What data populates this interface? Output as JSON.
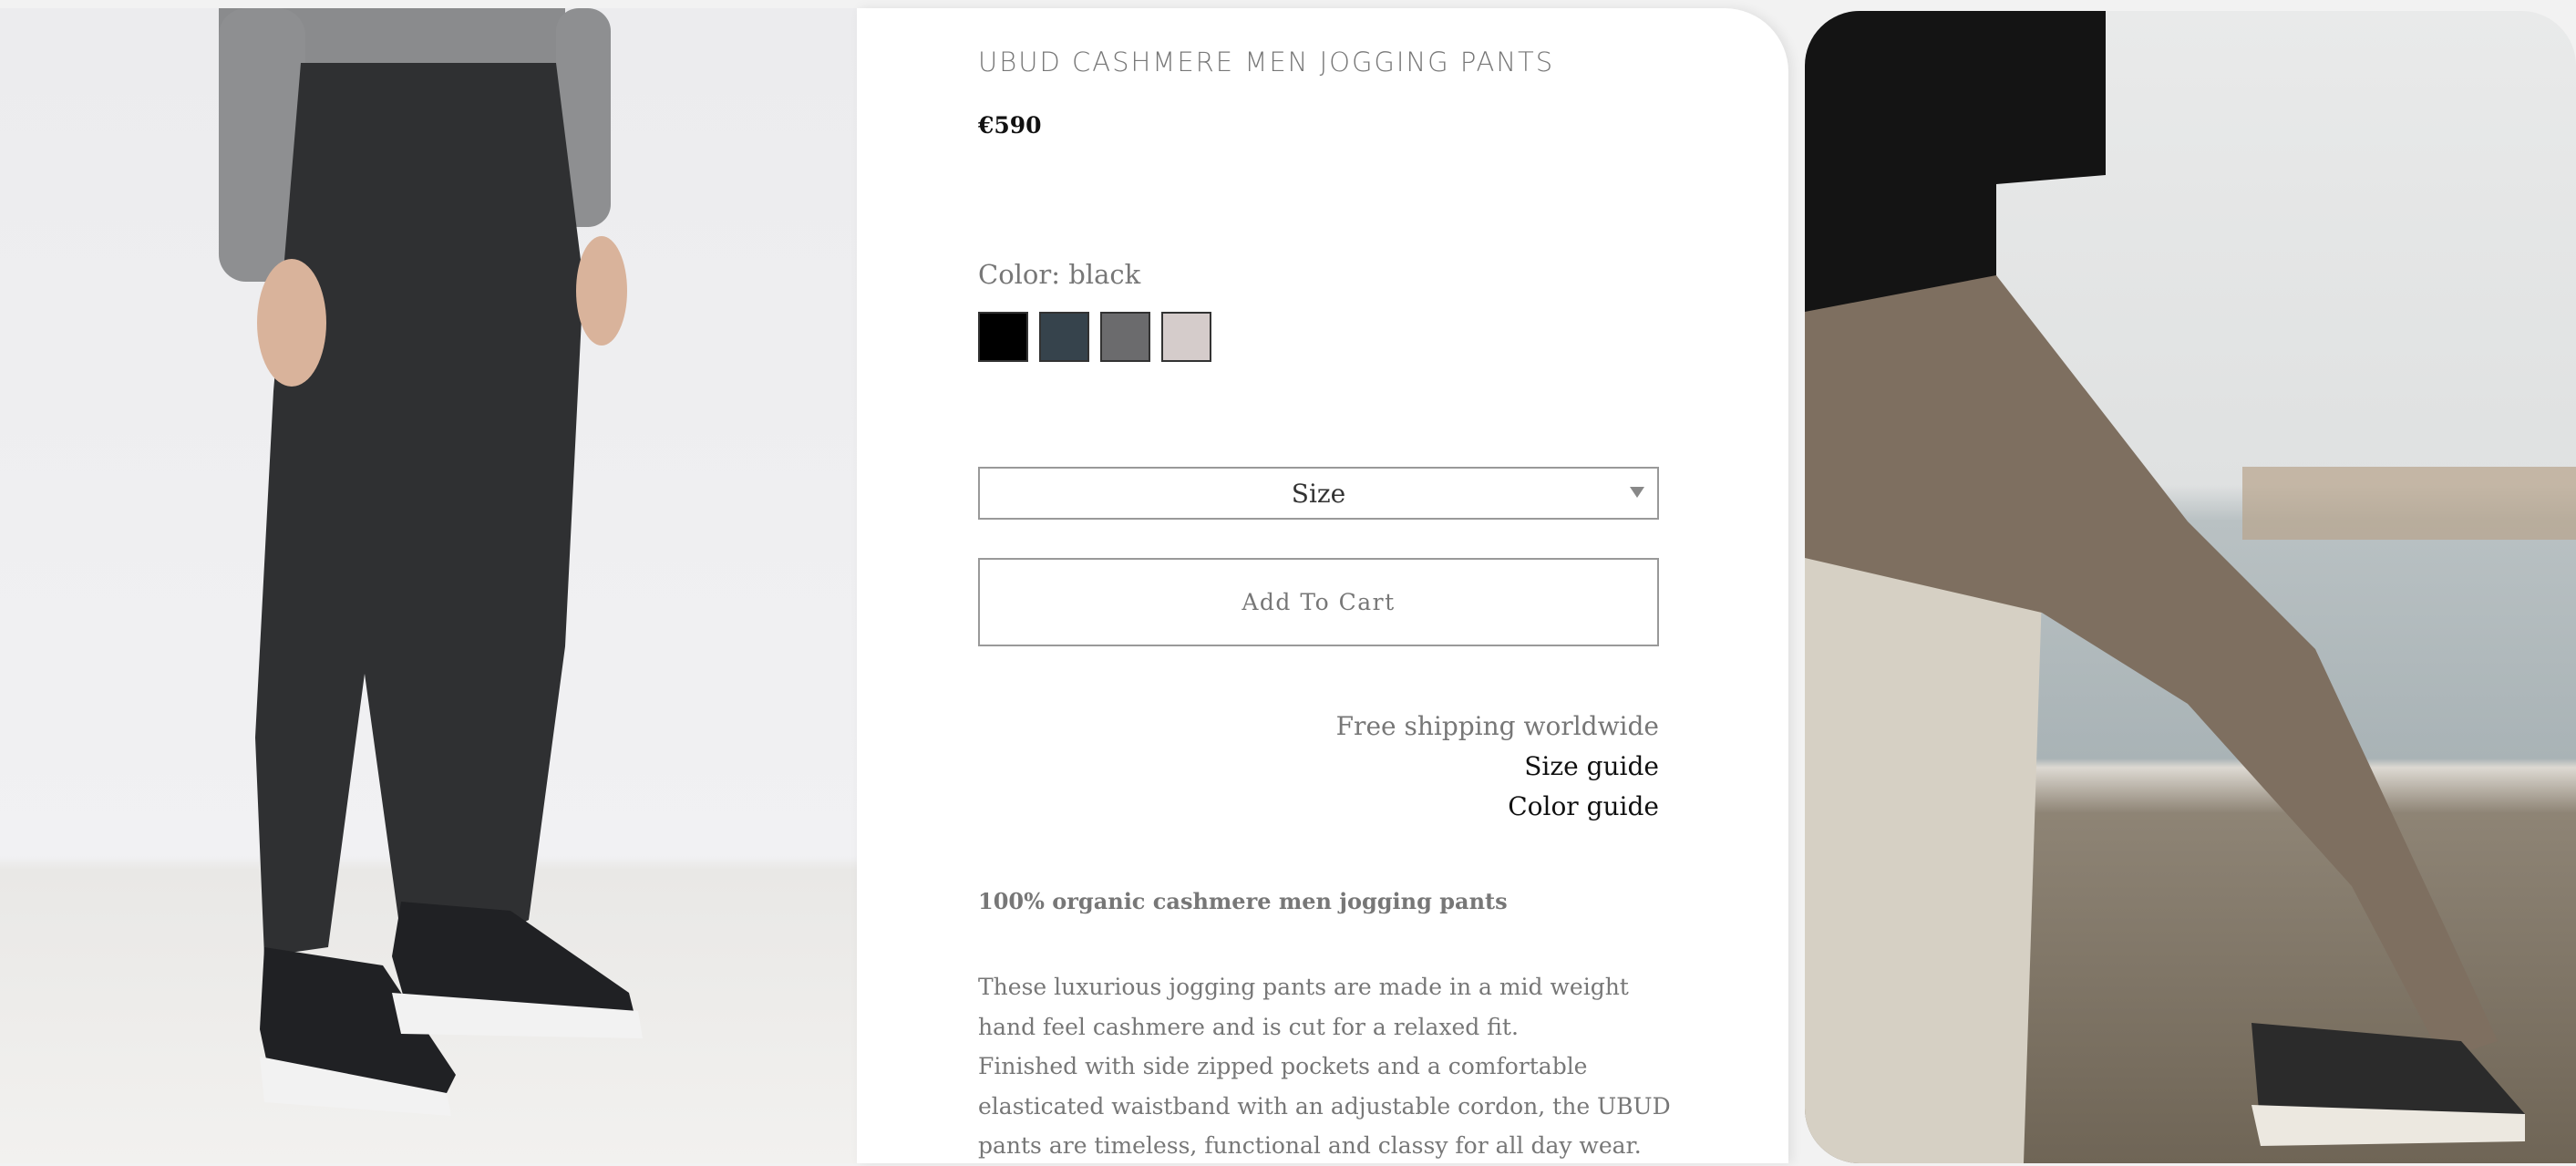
{
  "product": {
    "title": "UBUD CASHMERE MEN JOGGING PANTS",
    "price": "€590",
    "color_label": "Color: black",
    "swatches": [
      {
        "name": "black",
        "color": "#000000"
      },
      {
        "name": "navy",
        "color": "#36434c"
      },
      {
        "name": "grey",
        "color": "#6b6b6d"
      },
      {
        "name": "light-pink",
        "color": "#d5cccb"
      }
    ],
    "size_select": "Size",
    "add_to_cart": "Add To Cart",
    "shipping": "Free shipping worldwide",
    "size_guide": "Size guide",
    "color_guide": "Color guide",
    "description_heading": "100% organic cashmere men jogging pants",
    "description_lines": [
      "These luxurious jogging pants are made in a mid weight",
      "hand feel cashmere and is cut for a relaxed fit.",
      "Finished with side zipped pockets and a comfortable",
      "elasticated waistband with an adjustable cordon, the UBUD",
      "pants are timeless, functional and classy for all day wear."
    ]
  }
}
